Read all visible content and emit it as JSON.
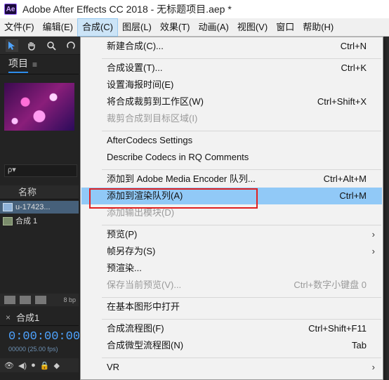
{
  "window": {
    "app_icon": "Ae",
    "title": "Adobe After Effects CC 2018 - 无标题项目.aep *"
  },
  "menubar": [
    "文件(F)",
    "编辑(E)",
    "合成(C)",
    "图层(L)",
    "效果(T)",
    "动画(A)",
    "视图(V)",
    "窗口",
    "帮助(H)"
  ],
  "project_panel": {
    "tab": "项目",
    "search_placeholder": "ρ▾",
    "column_name": "名称",
    "items": [
      {
        "label": "u-17423..."
      },
      {
        "label": "合成 1"
      }
    ],
    "bit_depth": "8 bp"
  },
  "timeline": {
    "tab": "合成1",
    "timecode": "0:00:00:00",
    "fps": "00000 (25.00 fps)"
  },
  "menu": {
    "new_comp": {
      "label": "新建合成(C)...",
      "shortcut": "Ctrl+N"
    },
    "comp_settings": {
      "label": "合成设置(T)...",
      "shortcut": "Ctrl+K"
    },
    "poster_time": {
      "label": "设置海报时间(E)"
    },
    "trim_comp": {
      "label": "将合成裁剪到工作区(W)",
      "shortcut": "Ctrl+Shift+X"
    },
    "crop_comp": {
      "label": "裁剪合成到目标区域(I)"
    },
    "aftercodecs": {
      "label": "AfterCodecs Settings"
    },
    "describe_codecs": {
      "label": "Describe Codecs in RQ Comments"
    },
    "add_ame": {
      "label": "添加到 Adobe Media Encoder 队列...",
      "shortcut": "Ctrl+Alt+M"
    },
    "add_render": {
      "label": "添加到渲染队列(A)",
      "shortcut": "Ctrl+M"
    },
    "add_output": {
      "label": "添加输出模块(D)"
    },
    "preview": {
      "label": "预览(P)"
    },
    "save_frame": {
      "label": "帧另存为(S)"
    },
    "prerender": {
      "label": "预渲染..."
    },
    "save_preview": {
      "label": "保存当前预览(V)...",
      "shortcut": "Ctrl+数字小键盘 0"
    },
    "open_essential": {
      "label": "在基本图形中打开"
    },
    "flowchart": {
      "label": "合成流程图(F)",
      "shortcut": "Ctrl+Shift+F11"
    },
    "mini_flowchart": {
      "label": "合成微型流程图(N)",
      "shortcut": "Tab"
    },
    "vr": {
      "label": "VR"
    }
  }
}
